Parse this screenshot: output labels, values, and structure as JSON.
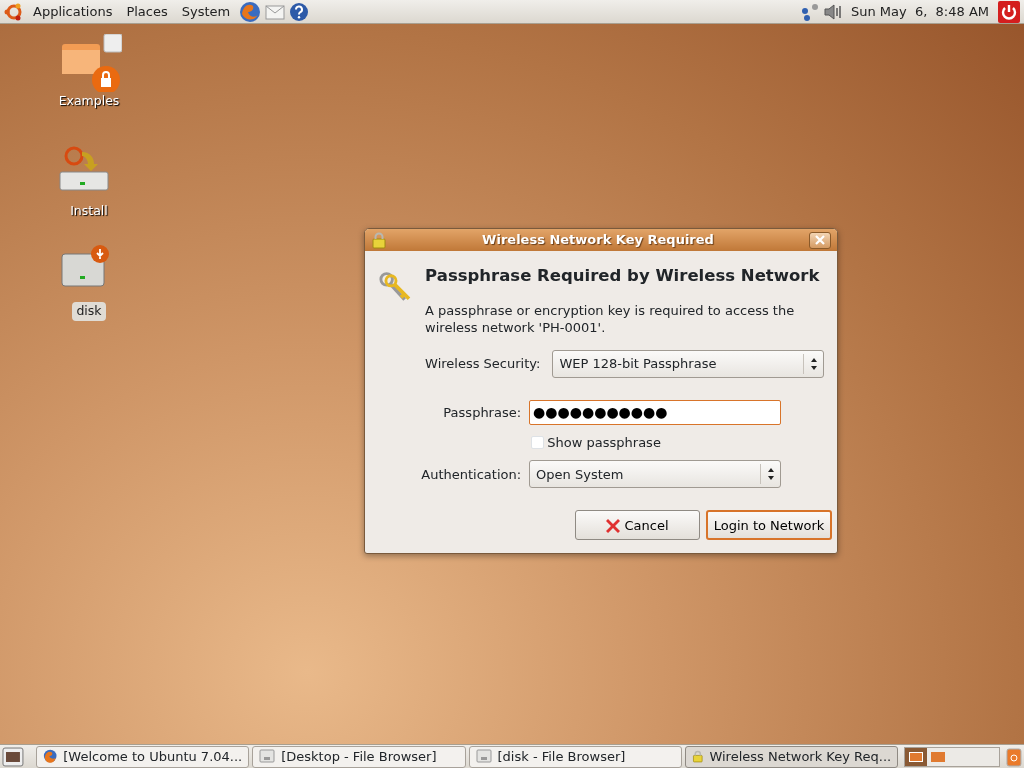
{
  "top_panel": {
    "menus": [
      "Applications",
      "Places",
      "System"
    ],
    "clock": "Sun May  6,  8:48 AM"
  },
  "desktop_icons": [
    {
      "kind": "folder",
      "label": "Examples"
    },
    {
      "kind": "installer",
      "label": "Install"
    },
    {
      "kind": "drive",
      "label": "disk",
      "selected": true
    }
  ],
  "dialog": {
    "title": "Wireless Network Key Required",
    "heading": "Passphrase Required by Wireless Network",
    "message": "A passphrase or encryption key is required to access the wireless network 'PH-0001'.",
    "wireless_security": {
      "label": "Wireless Security:",
      "value": "WEP 128-bit Passphrase"
    },
    "passphrase": {
      "label": "Passphrase:",
      "value": "●●●●●●●●●●●",
      "focused": true
    },
    "show_passphrase": {
      "label": "Show passphrase",
      "checked": false
    },
    "authentication": {
      "label": "Authentication:",
      "value": "Open System"
    },
    "buttons": [
      {
        "label": "Cancel",
        "kind": "cancel",
        "default": false
      },
      {
        "label": "Login to Network",
        "kind": "plain",
        "default": true
      }
    ]
  },
  "taskbar": {
    "windows": [
      {
        "label": "[Welcome to Ubuntu 7.04...",
        "kind": "browser",
        "selected": false
      },
      {
        "label": "[Desktop - File Browser]",
        "kind": "files",
        "selected": false
      },
      {
        "label": "[disk - File Browser]",
        "kind": "files",
        "selected": false
      },
      {
        "label": "Wireless Network Key Req...",
        "kind": "lock",
        "selected": true
      }
    ],
    "workspaces": [
      {
        "selected": true
      },
      {
        "selected": false
      }
    ]
  }
}
